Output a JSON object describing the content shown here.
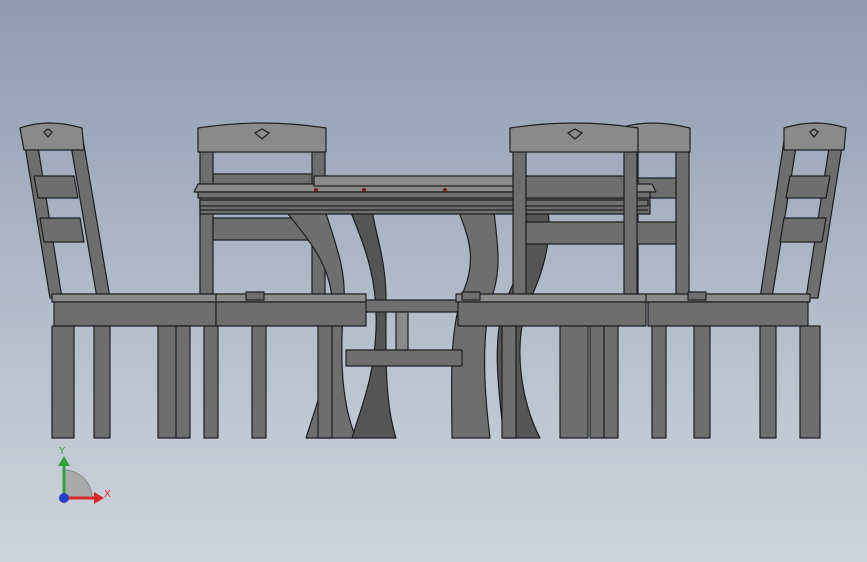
{
  "scene": {
    "model": "dining-table-with-six-chairs",
    "background_top": "#8d9bb0",
    "background_bottom": "#cfd4dc",
    "part_fill": "#6e6e6e",
    "part_fill_light": "#8a8a8a",
    "part_fill_dark": "#4a4a4a",
    "edge_color": "#1e1e1e"
  },
  "triad": {
    "y_label": "Y",
    "x_label": "X",
    "y_color": "#2fa33a",
    "x_color": "#d62a2a",
    "z_color": "#2b3ec9",
    "icon": "coordinate-triad-icon"
  }
}
